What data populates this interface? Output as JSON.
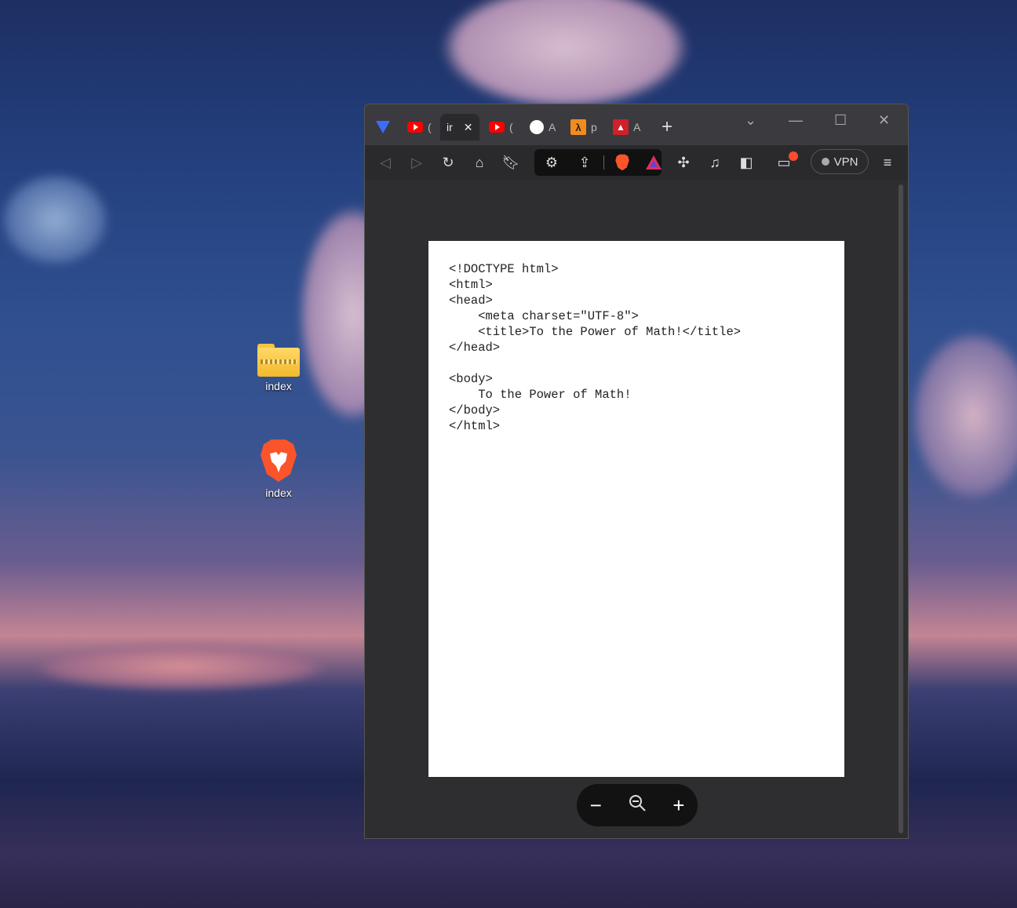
{
  "desktop": {
    "icons": [
      {
        "label": "index",
        "icon": "zip-folder-icon"
      },
      {
        "label": "index",
        "icon": "brave-browser-icon"
      }
    ]
  },
  "browser": {
    "tabs": [
      {
        "label": "",
        "icon": "brave-shield-icon"
      },
      {
        "label": "(",
        "icon": "youtube-icon"
      },
      {
        "label": "ir",
        "icon": "",
        "active": true,
        "close": "✕"
      },
      {
        "label": "(",
        "icon": "youtube-icon"
      },
      {
        "label": "A",
        "icon": "github-icon"
      },
      {
        "label": "p",
        "icon": "aws-lambda-icon"
      },
      {
        "label": "A",
        "icon": "red-triangle-icon"
      }
    ],
    "new_tab": "+",
    "vpn_label": "VPN",
    "menu_icon": "hamburger-icon"
  },
  "document": {
    "source_lines": [
      "<!DOCTYPE html>",
      "<html>",
      "<head>",
      "    <meta charset=\"UTF-8\">",
      "    <title>To the Power of Math!</title>",
      "</head>",
      "",
      "<body>",
      "    To the Power of Math!",
      "</body>",
      "</html>"
    ]
  },
  "zoom": {
    "minus": "−",
    "plus": "+"
  }
}
